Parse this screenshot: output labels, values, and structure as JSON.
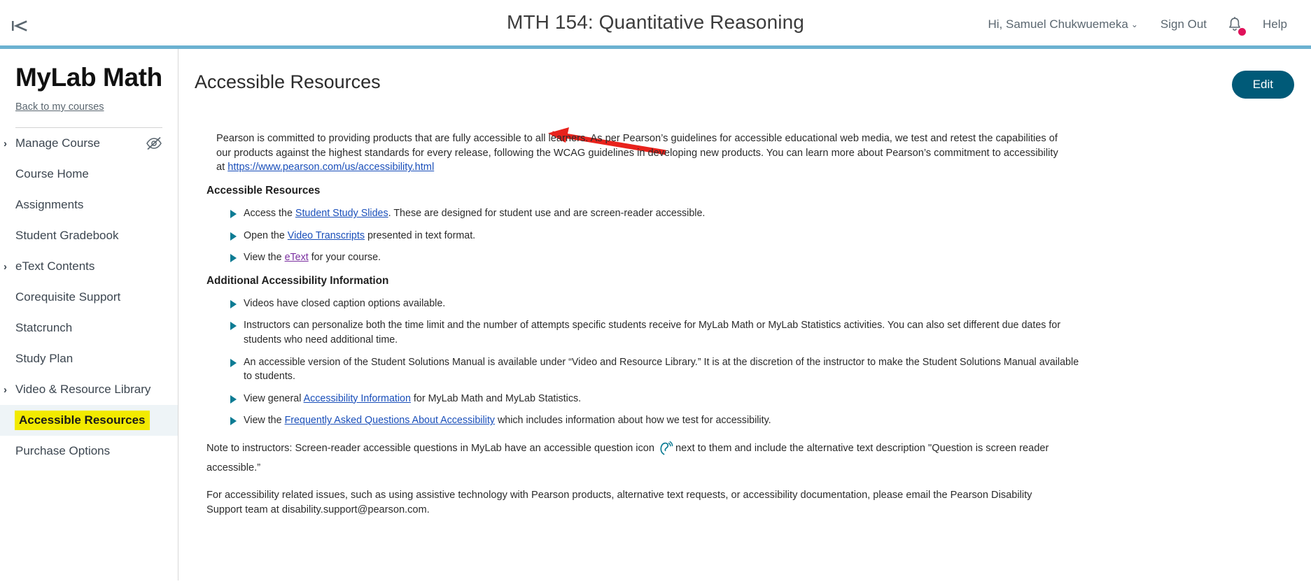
{
  "topbar": {
    "collapse_icon": "collapse-sidebar-icon",
    "course_title": "MTH 154: Quantitative Reasoning",
    "greeting": "Hi, Samuel Chukwuemeka",
    "greeting_caret": "⌄",
    "sign_out": "Sign Out",
    "bell_icon": "notification-bell-icon",
    "help": "Help",
    "accent_underline": "#6cb2d1",
    "notification_dot_color": "#e0125a"
  },
  "sidebar": {
    "brand": "MyLab Math",
    "back_link": "Back to my courses",
    "eye_icon": "hidden-eye-icon",
    "items": [
      {
        "label": "Manage Course",
        "chevron": "›",
        "has_chevron": true,
        "active": false,
        "highlighted": false,
        "has_eye": true
      },
      {
        "label": "Course Home",
        "chevron": "",
        "has_chevron": false,
        "active": false,
        "highlighted": false,
        "has_eye": false
      },
      {
        "label": "Assignments",
        "chevron": "",
        "has_chevron": false,
        "active": false,
        "highlighted": false,
        "has_eye": false
      },
      {
        "label": "Student Gradebook",
        "chevron": "",
        "has_chevron": false,
        "active": false,
        "highlighted": false,
        "has_eye": false
      },
      {
        "label": "eText Contents",
        "chevron": "›",
        "has_chevron": true,
        "active": false,
        "highlighted": false,
        "has_eye": false
      },
      {
        "label": "Corequisite Support",
        "chevron": "",
        "has_chevron": false,
        "active": false,
        "highlighted": false,
        "has_eye": false
      },
      {
        "label": "Statcrunch",
        "chevron": "",
        "has_chevron": false,
        "active": false,
        "highlighted": false,
        "has_eye": false
      },
      {
        "label": "Study Plan",
        "chevron": "",
        "has_chevron": false,
        "active": false,
        "highlighted": false,
        "has_eye": false
      },
      {
        "label": "Video & Resource Library",
        "chevron": "›",
        "has_chevron": true,
        "active": false,
        "highlighted": false,
        "has_eye": false
      },
      {
        "label": "Accessible Resources",
        "chevron": "",
        "has_chevron": false,
        "active": true,
        "highlighted": true,
        "has_eye": false
      },
      {
        "label": "Purchase Options",
        "chevron": "",
        "has_chevron": false,
        "active": false,
        "highlighted": false,
        "has_eye": false
      }
    ],
    "highlight_color": "#f2ea00",
    "active_row_color": "#eef4f7"
  },
  "main": {
    "page_title": "Accessible Resources",
    "edit_button": "Edit",
    "edit_button_color": "#005a78",
    "annotation": {
      "type": "red-arrow",
      "color": "#e8221c",
      "points_to": "page-title"
    }
  },
  "content": {
    "intro_part1": "Pearson is committed to providing products that are fully accessible to all learners. As per Pearson’s guidelines for accessible educational web media, we test and retest the capabilities of our products against the highest standards for every release, following the WCAG guidelines in developing new products. You can learn more about Pearson’s commitment to accessibility at ",
    "intro_link": "https://www.pearson.com/us/accessibility.html",
    "section1_heading": "Accessible Resources",
    "section1_bullets": [
      {
        "pre": "Access the ",
        "link": "Student Study Slides",
        "link_state": "normal",
        "post": ". These are designed for student use and are screen-reader accessible."
      },
      {
        "pre": "Open the ",
        "link": "Video Transcripts",
        "link_state": "normal",
        "post": " presented in text format."
      },
      {
        "pre": "View the ",
        "link": "eText",
        "link_state": "visited",
        "post": " for your course."
      }
    ],
    "section2_heading": "Additional Accessibility Information",
    "section2_bullets": [
      {
        "pre": "Videos have closed caption options available.",
        "link": "",
        "link_state": "none",
        "post": ""
      },
      {
        "pre": "Instructors can personalize both the time limit and the number of attempts specific students receive for MyLab Math or MyLab Statistics activities. You can also set different due dates for students who need additional time.",
        "link": "",
        "link_state": "none",
        "post": ""
      },
      {
        "pre": "An accessible version of the Student Solutions Manual is available under “Video and Resource Library.” It is at the discretion of the instructor to make the Student Solutions Manual available to students.",
        "link": "",
        "link_state": "none",
        "post": ""
      },
      {
        "pre": "View general ",
        "link": "Accessibility Information",
        "link_state": "normal",
        "post": " for MyLab Math and MyLab Statistics."
      },
      {
        "pre": "View the ",
        "link": "Frequently Asked Questions About Accessibility",
        "link_state": "normal",
        "post": " which includes information about how we test for accessibility."
      }
    ],
    "note_part1": "Note to instructors: Screen-reader accessible questions in MyLab have an accessible question icon",
    "note_icon": "accessible-question-ear-icon",
    "note_part2": "next to them and include the alternative text description \"Question is screen reader accessible.”",
    "footer_note": "For accessibility related issues, such as using assistive technology with Pearson products, alternative text requests, or accessibility documentation, please email the Pearson Disability Support team at disability.support@pearson.com.",
    "bullet_marker_color": "#0d7c94",
    "link_color": "#1a4fba",
    "visited_link_color": "#7b30a0"
  }
}
